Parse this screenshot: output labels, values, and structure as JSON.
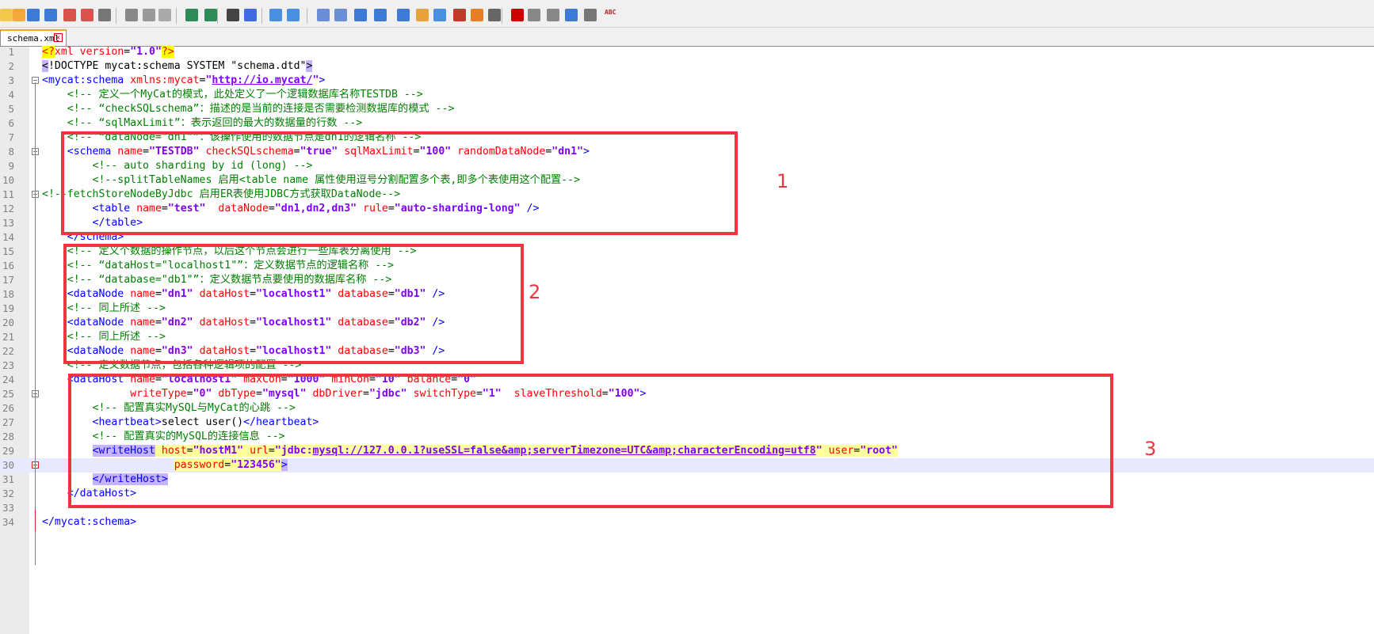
{
  "tab": {
    "label": "schema.xml"
  },
  "toolbar_icons": [
    "new-file-icon",
    "open-file-icon",
    "save-icon",
    "save-all-icon",
    "close-icon",
    "close-all-icon",
    "print-icon",
    "cut-icon",
    "copy-icon",
    "paste-icon",
    "undo-icon",
    "redo-icon",
    "find-icon",
    "replace-icon",
    "zoom-in-icon",
    "zoom-out-icon",
    "sync-v-icon",
    "sync-h-icon",
    "word-wrap-icon",
    "all-chars-icon",
    "indent-guide-icon",
    "udl-icon",
    "doc-map-icon",
    "function-list-icon",
    "folder-workspace-icon",
    "monitor-icon",
    "record-macro-icon",
    "stop-record-icon",
    "play-macro-icon",
    "run-macro-multiple-icon",
    "save-macro-icon",
    "spell-check-icon"
  ],
  "annotations": [
    "1",
    "2",
    "3"
  ],
  "lines": [
    [
      [
        "pi",
        "<?"
      ],
      [
        "attr",
        "xml version"
      ],
      [
        "",
        "="
      ],
      [
        "val",
        "\"1.0\""
      ],
      [
        "pi",
        "?>"
      ]
    ],
    [
      [
        "hl",
        "<"
      ],
      [
        "dt",
        "!DOCTYPE mycat:schema SYSTEM \"schema.dtd\""
      ],
      [
        "hl",
        ">"
      ]
    ],
    [
      [
        "tag",
        "<mycat:schema"
      ],
      [
        "",
        " "
      ],
      [
        "attr",
        "xmlns:mycat"
      ],
      [
        "",
        "="
      ],
      [
        "val",
        "\""
      ],
      [
        "url",
        "http://io.mycat/"
      ],
      [
        "val",
        "\""
      ],
      [
        "tag",
        ">"
      ]
    ],
    [
      [
        "",
        "    "
      ],
      [
        "cmt",
        "<!-- 定义一个MyCat的模式，此处定义了一个逻辑数据库名称TESTDB -->"
      ]
    ],
    [
      [
        "",
        "    "
      ],
      [
        "cmt",
        "<!-- “checkSQLschema”：描述的是当前的连接是否需要检测数据库的模式 -->"
      ]
    ],
    [
      [
        "",
        "    "
      ],
      [
        "cmt",
        "<!-- “sqlMaxLimit”：表示返回的最大的数据量的行数 -->"
      ]
    ],
    [
      [
        "",
        "    "
      ],
      [
        "cmt",
        "<!-- “dataNode=\"dn1\"”：该操作使用的数据节点是dn1的逻辑名称 -->"
      ]
    ],
    [
      [
        "",
        "    "
      ],
      [
        "tag",
        "<schema"
      ],
      [
        "",
        " "
      ],
      [
        "attr",
        "name"
      ],
      [
        "",
        "="
      ],
      [
        "val",
        "\"TESTDB\""
      ],
      [
        "",
        " "
      ],
      [
        "attr",
        "checkSQLschema"
      ],
      [
        "",
        "="
      ],
      [
        "val",
        "\"true\""
      ],
      [
        "",
        " "
      ],
      [
        "attr",
        "sqlMaxLimit"
      ],
      [
        "",
        "="
      ],
      [
        "val",
        "\"100\""
      ],
      [
        "",
        " "
      ],
      [
        "attr",
        "randomDataNode"
      ],
      [
        "",
        "="
      ],
      [
        "val",
        "\"dn1\""
      ],
      [
        "tag",
        ">"
      ]
    ],
    [
      [
        "",
        "        "
      ],
      [
        "cmt",
        "<!-- auto sharding by id (long) -->"
      ]
    ],
    [
      [
        "",
        "        "
      ],
      [
        "cmt",
        "<!--splitTableNames 启用<table name 属性使用逗号分割配置多个表,即多个表使用这个配置-->"
      ]
    ],
    [
      [
        "cmt",
        "<!--fetchStoreNodeByJdbc 启用ER表使用JDBC方式获取DataNode-->"
      ]
    ],
    [
      [
        "",
        "        "
      ],
      [
        "tag",
        "<table"
      ],
      [
        "",
        " "
      ],
      [
        "attr",
        "name"
      ],
      [
        "",
        "="
      ],
      [
        "val",
        "\"test\""
      ],
      [
        "",
        "  "
      ],
      [
        "attr",
        "dataNode"
      ],
      [
        "",
        "="
      ],
      [
        "val",
        "\"dn1,dn2,dn3\""
      ],
      [
        "",
        " "
      ],
      [
        "attr",
        "rule"
      ],
      [
        "",
        "="
      ],
      [
        "val",
        "\"auto-sharding-long\""
      ],
      [
        "",
        " "
      ],
      [
        "tag",
        "/>"
      ]
    ],
    [
      [
        "",
        "        "
      ],
      [
        "tag",
        "</table>"
      ]
    ],
    [
      [
        "",
        "    "
      ],
      [
        "tag",
        "</schema>"
      ]
    ],
    [
      [
        "",
        "    "
      ],
      [
        "cmt",
        "<!-- 定义个数据的操作节点，以后这个节点会进行一些库表分离使用 -->"
      ]
    ],
    [
      [
        "",
        "    "
      ],
      [
        "cmt",
        "<!-- “dataHost=\"localhost1\"”：定义数据节点的逻辑名称 -->"
      ]
    ],
    [
      [
        "",
        "    "
      ],
      [
        "cmt",
        "<!-- “database=\"db1\"”：定义数据节点要使用的数据库名称 -->"
      ]
    ],
    [
      [
        "",
        "    "
      ],
      [
        "tag",
        "<dataNode"
      ],
      [
        "",
        " "
      ],
      [
        "attr",
        "name"
      ],
      [
        "",
        "="
      ],
      [
        "val",
        "\"dn1\""
      ],
      [
        "",
        " "
      ],
      [
        "attr",
        "dataHost"
      ],
      [
        "",
        "="
      ],
      [
        "val",
        "\"localhost1\""
      ],
      [
        "",
        " "
      ],
      [
        "attr",
        "database"
      ],
      [
        "",
        "="
      ],
      [
        "val",
        "\"db1\""
      ],
      [
        "",
        " "
      ],
      [
        "tag",
        "/>"
      ]
    ],
    [
      [
        "",
        "    "
      ],
      [
        "cmt",
        "<!-- 同上所述 -->"
      ]
    ],
    [
      [
        "",
        "    "
      ],
      [
        "tag",
        "<dataNode"
      ],
      [
        "",
        " "
      ],
      [
        "attr",
        "name"
      ],
      [
        "",
        "="
      ],
      [
        "val",
        "\"dn2\""
      ],
      [
        "",
        " "
      ],
      [
        "attr",
        "dataHost"
      ],
      [
        "",
        "="
      ],
      [
        "val",
        "\"localhost1\""
      ],
      [
        "",
        " "
      ],
      [
        "attr",
        "database"
      ],
      [
        "",
        "="
      ],
      [
        "val",
        "\"db2\""
      ],
      [
        "",
        " "
      ],
      [
        "tag",
        "/>"
      ]
    ],
    [
      [
        "",
        "    "
      ],
      [
        "cmt",
        "<!-- 同上所述 -->"
      ]
    ],
    [
      [
        "",
        "    "
      ],
      [
        "tag",
        "<dataNode"
      ],
      [
        "",
        " "
      ],
      [
        "attr",
        "name"
      ],
      [
        "",
        "="
      ],
      [
        "val",
        "\"dn3\""
      ],
      [
        "",
        " "
      ],
      [
        "attr",
        "dataHost"
      ],
      [
        "",
        "="
      ],
      [
        "val",
        "\"localhost1\""
      ],
      [
        "",
        " "
      ],
      [
        "attr",
        "database"
      ],
      [
        "",
        "="
      ],
      [
        "val",
        "\"db3\""
      ],
      [
        "",
        " "
      ],
      [
        "tag",
        "/>"
      ]
    ],
    [
      [
        "",
        "    "
      ],
      [
        "cmt",
        "<!-- 定义数据节点，包括各种逻辑项的配置 -->"
      ]
    ],
    [
      [
        "",
        "    "
      ],
      [
        "tag",
        "<dataHost"
      ],
      [
        "",
        " "
      ],
      [
        "attr",
        "name"
      ],
      [
        "",
        "="
      ],
      [
        "val",
        "\"localhost1\""
      ],
      [
        "",
        " "
      ],
      [
        "attr",
        "maxCon"
      ],
      [
        "",
        "="
      ],
      [
        "val",
        "\"1000\""
      ],
      [
        "",
        " "
      ],
      [
        "attr",
        "minCon"
      ],
      [
        "",
        "="
      ],
      [
        "val",
        "\"10\""
      ],
      [
        "",
        " "
      ],
      [
        "attr",
        "balance"
      ],
      [
        "",
        "="
      ],
      [
        "val",
        "\"0\""
      ]
    ],
    [
      [
        "",
        "              "
      ],
      [
        "attr",
        "writeType"
      ],
      [
        "",
        "="
      ],
      [
        "val",
        "\"0\""
      ],
      [
        "",
        " "
      ],
      [
        "attr",
        "dbType"
      ],
      [
        "",
        "="
      ],
      [
        "val",
        "\"mysql\""
      ],
      [
        "",
        " "
      ],
      [
        "attr",
        "dbDriver"
      ],
      [
        "",
        "="
      ],
      [
        "val",
        "\"jdbc\""
      ],
      [
        "",
        " "
      ],
      [
        "attr",
        "switchType"
      ],
      [
        "",
        "="
      ],
      [
        "val",
        "\"1\""
      ],
      [
        "",
        "  "
      ],
      [
        "attr",
        "slaveThreshold"
      ],
      [
        "",
        "="
      ],
      [
        "val",
        "\"100\""
      ],
      [
        "tag",
        ">"
      ]
    ],
    [
      [
        "",
        "        "
      ],
      [
        "cmt",
        "<!-- 配置真实MySQL与MyCat的心跳 -->"
      ]
    ],
    [
      [
        "",
        "        "
      ],
      [
        "tag",
        "<heartbeat>"
      ],
      [
        "",
        "select user()"
      ],
      [
        "tag",
        "</heartbeat>"
      ]
    ],
    [
      [
        "",
        "        "
      ],
      [
        "cmt",
        "<!-- 配置真实的MySQL的连接信息 -->"
      ]
    ],
    [
      [
        "",
        "        "
      ],
      [
        "taghl",
        "<writeHost"
      ],
      [
        "yl",
        " "
      ],
      [
        "attryl",
        "host"
      ],
      [
        "yl",
        "="
      ],
      [
        "valyl",
        "\"hostM1\""
      ],
      [
        "yl",
        " "
      ],
      [
        "attryl",
        "url"
      ],
      [
        "yl",
        "="
      ],
      [
        "valyl",
        "\"jdbc:"
      ],
      [
        "urlyl",
        "mysql://127.0.0.1?useSSL=false&amp;serverTimezone=UTC&amp;characterEncoding=utf8"
      ],
      [
        "valyl",
        "\""
      ],
      [
        "yl",
        " "
      ],
      [
        "attryl",
        "user"
      ],
      [
        "yl",
        "="
      ],
      [
        "valyl",
        "\"root\""
      ]
    ],
    [
      [
        "",
        "                     "
      ],
      [
        "attryl",
        "password"
      ],
      [
        "yl",
        "="
      ],
      [
        "valyl",
        "\"123456\""
      ],
      [
        "taghl",
        ">"
      ]
    ],
    [
      [
        "",
        "        "
      ],
      [
        "taghl",
        "</writeHost>"
      ]
    ],
    [
      [
        "",
        "    "
      ],
      [
        "tag",
        "</dataHost>"
      ]
    ],
    [
      [
        "",
        ""
      ]
    ],
    [
      [
        "tag",
        "</mycat:schema>"
      ]
    ]
  ]
}
